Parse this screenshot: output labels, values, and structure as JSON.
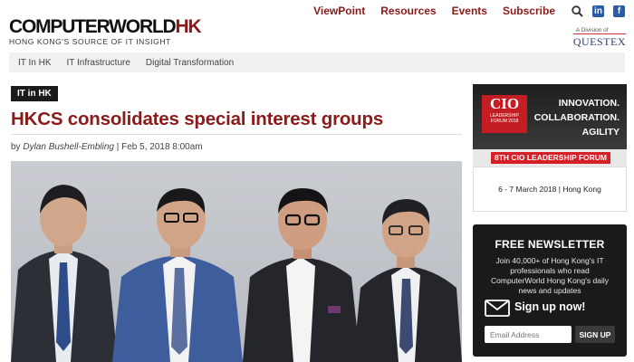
{
  "header": {
    "logo_main": "COMPUTERWORLD",
    "logo_accent": "HK",
    "logo_tagline": "HONG KONG'S SOURCE OF IT INSIGHT",
    "nav": [
      "ViewPoint",
      "Resources",
      "Events",
      "Subscribe"
    ],
    "icons": [
      "search-icon",
      "linkedin-icon",
      "facebook-icon"
    ],
    "questex_small": "A Division of",
    "questex_brand": "QUESTEX"
  },
  "subnav": [
    "IT In HK",
    "IT Infrastructure",
    "Digital Transformation"
  ],
  "article": {
    "tag": "IT in HK",
    "title": "HKCS consolidates special interest groups",
    "by": "by",
    "author": "Dylan Bushell-Embling",
    "sep": "|",
    "date": "Feb 5, 2018 8:00am"
  },
  "ad": {
    "logo_big": "CIO",
    "logo_small": "LEADERSHIP FORUM 2018",
    "line1": "INNOVATION.",
    "line2": "COLLABORATION.",
    "line3": "AGILITY",
    "pill": "8TH CIO LEADERSHIP FORUM",
    "dates": "6 - 7 March 2018 | Hong Kong"
  },
  "newsletter": {
    "title": "FREE NEWSLETTER",
    "description": "Join 40,000+ of Hong Kong's IT professionals who read ComputerWorld Hong Kong's daily news and updates",
    "signup_text": "Sign up now!",
    "email_placeholder": "Email Address",
    "button": "SIGN UP"
  },
  "colors": {
    "brand": "#8b1a1a",
    "dark": "#1a1a1a",
    "ad_red": "#d41f27",
    "social_blue": "#2a5ba6"
  }
}
